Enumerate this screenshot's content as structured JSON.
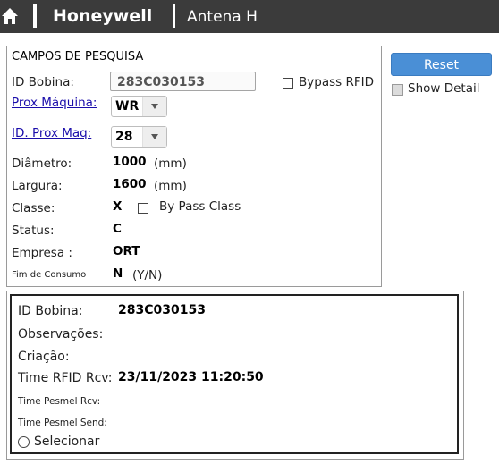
{
  "header": {
    "brand": "Honeywell",
    "app": "Antena H"
  },
  "search": {
    "title": "CAMPOS DE PESQUISA",
    "id_bobina_label": "ID Bobina:",
    "id_bobina_value": "283C030153",
    "bypass_rfid_label": "Bypass RFID",
    "prox_maquina_label": "Prox Máquina:",
    "prox_maquina_value": "WR",
    "id_prox_maq_label": "ID. Prox Maq:",
    "id_prox_maq_value": "28",
    "diametro_label": "Diâmetro:",
    "diametro_value": "1000",
    "diametro_unit": "(mm)",
    "largura_label": "Largura:",
    "largura_value": "1600",
    "largura_unit": "(mm)",
    "classe_label": "Classe:",
    "classe_value": "X",
    "bypass_class_label": "By Pass Class",
    "status_label": "Status:",
    "status_value": "C",
    "empresa_label": "Empresa :",
    "empresa_value": "ORT",
    "fim_consumo_label": "Fim de Consumo",
    "fim_consumo_value": "N",
    "fim_consumo_unit": "(Y/N)"
  },
  "actions": {
    "reset_label": "Reset",
    "show_detail_label": "Show Detail"
  },
  "result": {
    "id_bobina_label": "ID Bobina:",
    "id_bobina_value": "283C030153",
    "observacoes_label": "Observações:",
    "criacao_label": "Criação:",
    "time_rfid_label": "Time RFID Rcv:",
    "time_rfid_value": "23/11/2023 11:20:50",
    "time_pesmel_rcv_label": "Time Pesmel Rcv:",
    "time_pesmel_send_label": "Time Pesmel Send:",
    "selecionar_label": "Selecionar"
  },
  "icons": {
    "home": "home-icon",
    "dropdown": "chevron-down-icon"
  },
  "colors": {
    "topbar": "#3b3b3b",
    "reset_button": "#4a8fd6",
    "link": "#1a0dab"
  }
}
